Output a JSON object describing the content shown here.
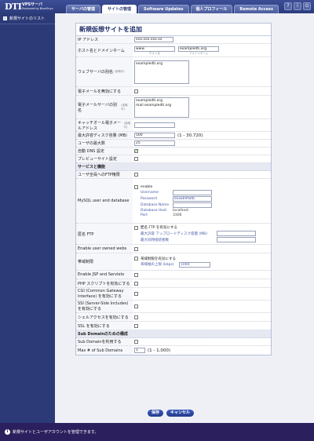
{
  "header": {
    "logo": "DTI",
    "product": "VPSサーバ",
    "byline": "Produced by BlueOnyx",
    "tabs": [
      "サーバの管理",
      "サイトの管理",
      "Software Updates",
      "個人プロフィール",
      "Remote Access"
    ],
    "icons": [
      "help-icon",
      "info-icon",
      "logout-icon"
    ]
  },
  "sidebar": {
    "items": [
      {
        "label": "新規サイトのリスト"
      }
    ]
  },
  "form": {
    "title": "新規仮想サイトを追加",
    "ip_label": "IP アドレス",
    "ip_value": "xxx.xxx.xxx.xx",
    "host_label": "ホスト名とドメインネーム",
    "host_value": "www",
    "host_caption": "ホスト名",
    "domain_value": "exampledti.org",
    "domain_caption": "ドメインネーム",
    "alias_label": "ウェブサーバの別名",
    "alias_hint": "(省略可)",
    "alias_value": "exampledti.org",
    "disable_mail_label": "電子メールを無効にする",
    "mail_alias_label": "電子メールサーバの別名",
    "mail_alias_hint": "(省略可)",
    "mail_alias_value": "exampledti.org\nmail.exampledti.org",
    "catchall_label": "キャッチオール電子メールアドレス",
    "catchall_hint": "(省略可)",
    "quota_label": "最大許容ディスク容量 (MB)",
    "quota_value": "500",
    "quota_range": "(1 - 30,720)",
    "max_users_label": "ユーザの最大数",
    "max_users_value": "25",
    "auto_dns_label": "自動 DNS 設定",
    "preview_label": "プレビューサイト設定",
    "services_header": "サービスと機能",
    "ftp_all_label": "ユーザ全員へのFTP権限",
    "mysql_label": "MySQL user and database",
    "mysql_enable": "enable",
    "mysql_username_label": "Username",
    "mysql_password_label": "Password",
    "mysql_password_value": "bSiwb9fwfb",
    "mysql_dbname_label": "Database Name",
    "mysql_host_label": "Database Host",
    "mysql_host_value": "localhost",
    "mysql_port_label": "Port",
    "mysql_port_value": "3306",
    "anon_ftp_label": "匿名 FTP",
    "anon_ftp_enable": "匿名 FTP を有効にする",
    "anon_ftp_quota_label": "最大許容 アップロードディスク容量 (MB)",
    "anon_ftp_conn_label": "最大同時接続者数",
    "user_webs_label": "Enable user owned webs",
    "bw_label": "帯域制限",
    "bw_enable": "帯域制限を有効にする",
    "bw_limit_label": "帯域幅の上限 (kbps)",
    "bw_limit_value": "1000",
    "jsp_label": "Enable JSP and Servlets",
    "php_label": "PHP スクリプトを有効にする",
    "cgi_label": "CGI (Common Gateway Interface) を有効にする",
    "ssi_label": "SSI (Server-Side Includes) を有効にする",
    "shell_label": "シェルアクセスを有効にする",
    "ssl_label": "SSL を有効にする",
    "subdomain_header": "Sub Domainのための構成",
    "subdomain_enable_label": "Sub Domainを利用する",
    "max_subdomain_label": "Max # of Sub Domains",
    "max_subdomain_value": "1",
    "max_subdomain_range": "(1 - 1,000)"
  },
  "buttons": {
    "save": "保存",
    "cancel": "キャンセル"
  },
  "footer": {
    "text": "新規サイトとユーザアカウントを管理できます。"
  }
}
